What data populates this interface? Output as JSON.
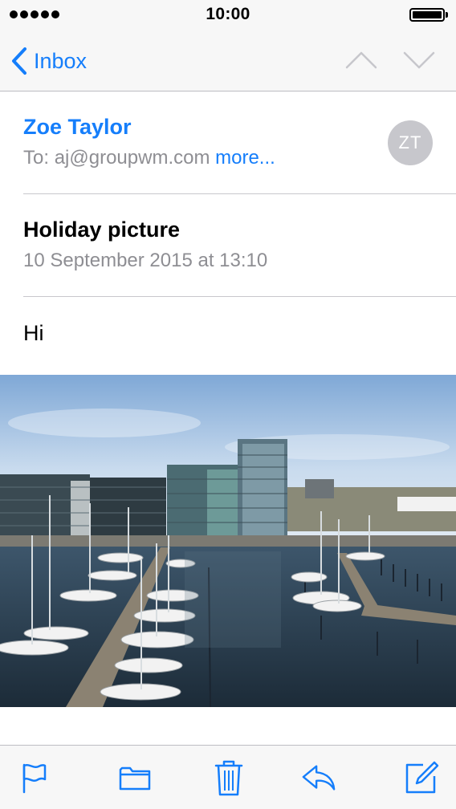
{
  "status_bar": {
    "time": "10:00"
  },
  "nav": {
    "back_label": "Inbox",
    "icons": [
      "chevron-left-icon",
      "chevron-up-icon",
      "chevron-down-icon"
    ]
  },
  "message": {
    "sender": "Zoe Taylor",
    "to_label": "To:",
    "to_address": "aj@groupwm.com",
    "more_label": "more...",
    "avatar_initials": "ZT",
    "subject": "Holiday picture",
    "date": "10 September 2015 at 13:10",
    "body": "Hi"
  },
  "toolbar": {
    "icons": [
      "flag-icon",
      "folder-icon",
      "trash-icon",
      "reply-icon",
      "compose-icon"
    ]
  },
  "colors": {
    "accent": "#157efb",
    "secondary_text": "#8e8e93",
    "avatar_bg": "#c7c7cc",
    "bar_bg": "#f7f7f7"
  }
}
